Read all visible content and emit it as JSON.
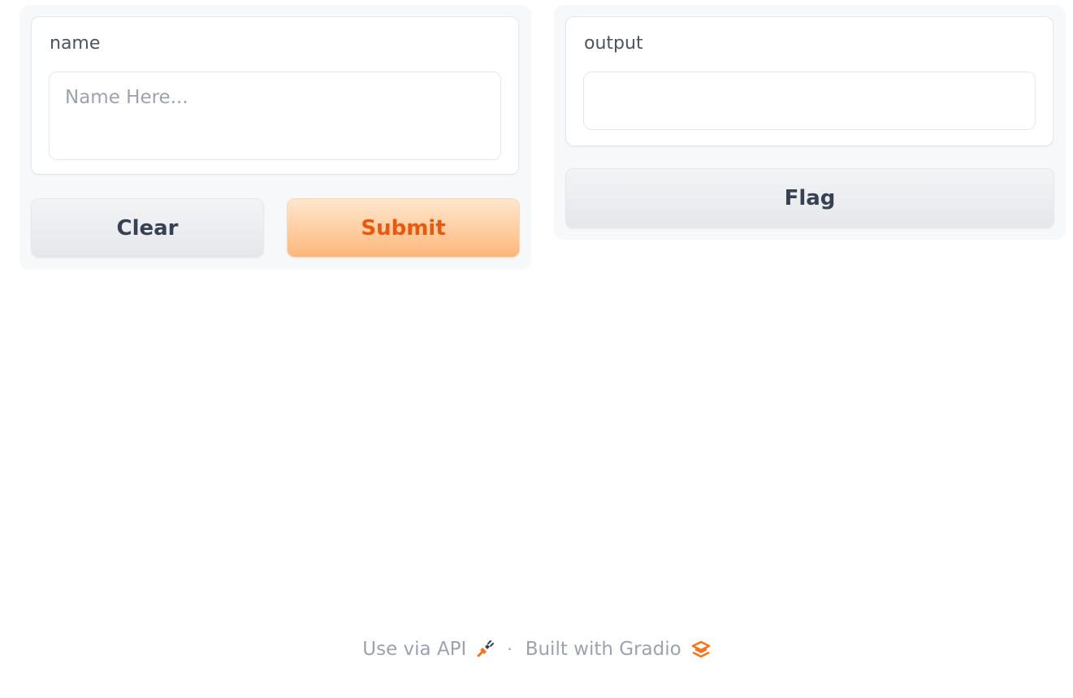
{
  "input": {
    "label": "name",
    "placeholder": "Name Here..."
  },
  "output": {
    "label": "output",
    "value": ""
  },
  "buttons": {
    "clear": "Clear",
    "submit": "Submit",
    "flag": "Flag"
  },
  "footer": {
    "api_link": "Use via API",
    "separator": "·",
    "built_with": "Built with Gradio"
  },
  "icons": {
    "api": "rocket-plug-icon",
    "gradio": "gradio-logo-icon"
  },
  "colors": {
    "accent": "#ea580c",
    "accent_light": "#fdb77a"
  }
}
